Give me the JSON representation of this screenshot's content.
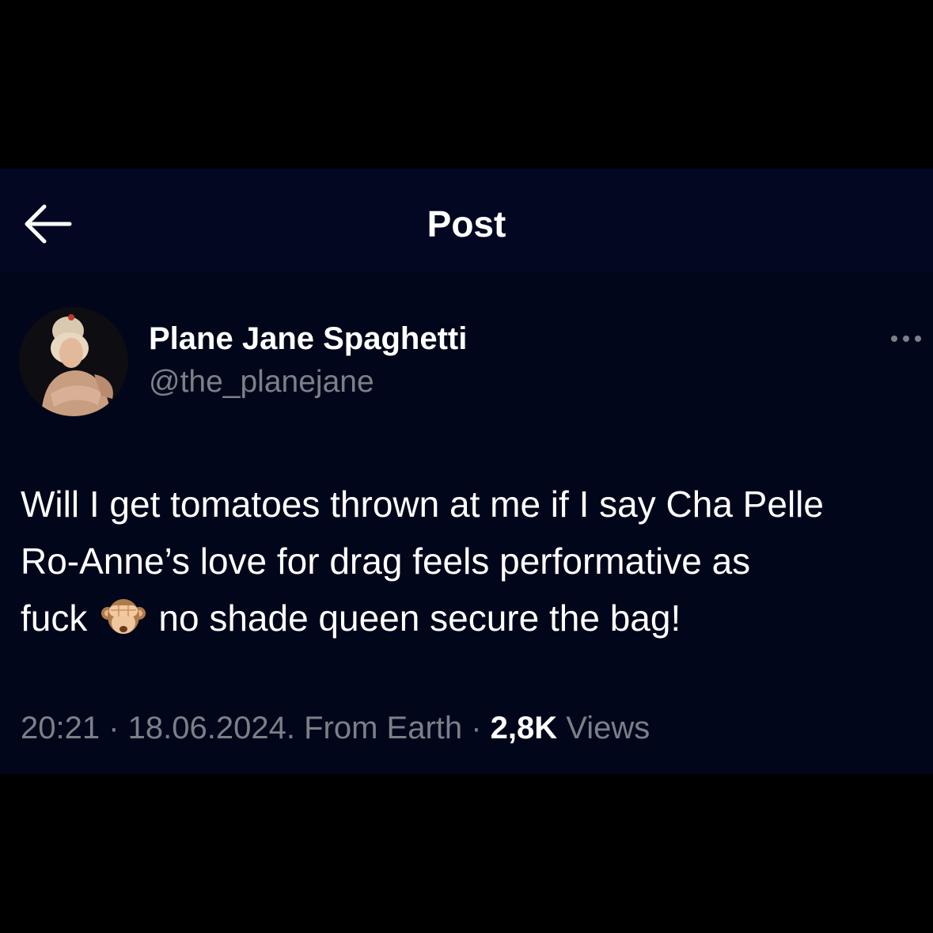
{
  "header": {
    "title": "Post",
    "back_icon": "arrow-left-icon"
  },
  "author": {
    "name": "Plane Jane Spaghetti",
    "handle": "@the_planejane",
    "avatar": "profile-photo"
  },
  "more_icon": "more-horizontal-icon",
  "tweet": {
    "line1": "Will I get tomatoes thrown at me if I say Cha Pelle",
    "line2": "Ro-Anne’s love for drag feels performative as",
    "line3_before": "fuck",
    "emoji": "see-no-evil-monkey-emoji",
    "line3_after": "no shade queen secure the bag!"
  },
  "meta": {
    "time": "20:21",
    "separator1": " · ",
    "date_source": "18.06.2024. From Earth",
    "separator2": " · ",
    "views_count": "2,8K",
    "views_label": " Views"
  },
  "colors": {
    "background": "#02061a",
    "header_background": "#030722",
    "text": "#ffffff",
    "secondary_text": "#7b8088"
  }
}
